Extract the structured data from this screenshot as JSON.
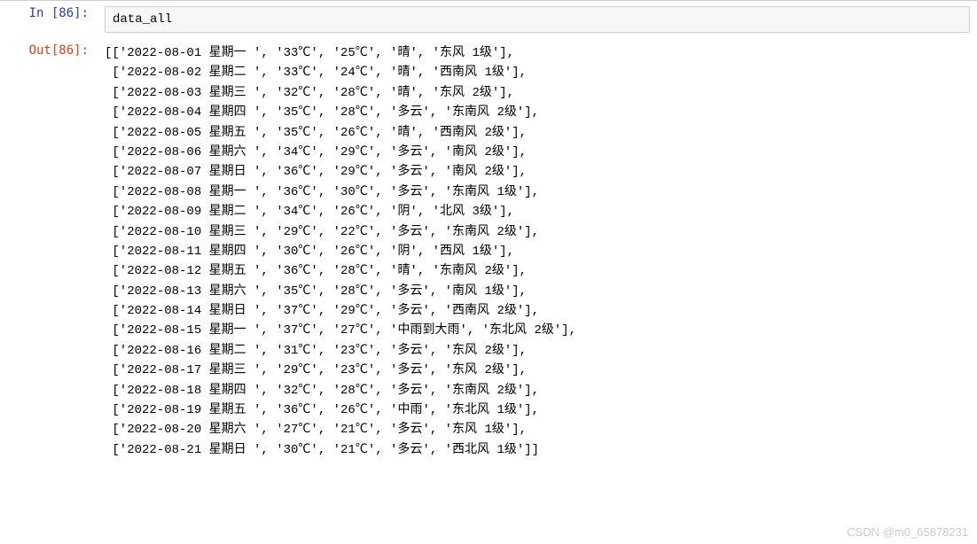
{
  "input": {
    "prompt": "In  [86]:",
    "code": "data_all"
  },
  "output": {
    "prompt": "Out[86]:",
    "rows": [
      [
        "2022-08-01 星期一 ",
        "33℃",
        "25℃",
        "晴",
        "东风 1级"
      ],
      [
        "2022-08-02 星期二 ",
        "33℃",
        "24℃",
        "晴",
        "西南风 1级"
      ],
      [
        "2022-08-03 星期三 ",
        "32℃",
        "28℃",
        "晴",
        "东风 2级"
      ],
      [
        "2022-08-04 星期四 ",
        "35℃",
        "28℃",
        "多云",
        "东南风 2级"
      ],
      [
        "2022-08-05 星期五 ",
        "35℃",
        "26℃",
        "晴",
        "西南风 2级"
      ],
      [
        "2022-08-06 星期六 ",
        "34℃",
        "29℃",
        "多云",
        "南风 2级"
      ],
      [
        "2022-08-07 星期日 ",
        "36℃",
        "29℃",
        "多云",
        "南风 2级"
      ],
      [
        "2022-08-08 星期一 ",
        "36℃",
        "30℃",
        "多云",
        "东南风 1级"
      ],
      [
        "2022-08-09 星期二 ",
        "34℃",
        "26℃",
        "阴",
        "北风 3级"
      ],
      [
        "2022-08-10 星期三 ",
        "29℃",
        "22℃",
        "多云",
        "东南风 2级"
      ],
      [
        "2022-08-11 星期四 ",
        "30℃",
        "26℃",
        "阴",
        "西风 1级"
      ],
      [
        "2022-08-12 星期五 ",
        "36℃",
        "28℃",
        "晴",
        "东南风 2级"
      ],
      [
        "2022-08-13 星期六 ",
        "35℃",
        "28℃",
        "多云",
        "南风 1级"
      ],
      [
        "2022-08-14 星期日 ",
        "37℃",
        "29℃",
        "多云",
        "西南风 2级"
      ],
      [
        "2022-08-15 星期一 ",
        "37℃",
        "27℃",
        "中雨到大雨",
        "东北风 2级"
      ],
      [
        "2022-08-16 星期二 ",
        "31℃",
        "23℃",
        "多云",
        "东风 2级"
      ],
      [
        "2022-08-17 星期三 ",
        "29℃",
        "23℃",
        "多云",
        "东风 2级"
      ],
      [
        "2022-08-18 星期四 ",
        "32℃",
        "28℃",
        "多云",
        "东南风 2级"
      ],
      [
        "2022-08-19 星期五 ",
        "36℃",
        "26℃",
        "中雨",
        "东北风 1级"
      ],
      [
        "2022-08-20 星期六 ",
        "27℃",
        "21℃",
        "多云",
        "东风 1级"
      ],
      [
        "2022-08-21 星期日 ",
        "30℃",
        "21℃",
        "多云",
        "西北风 1级"
      ]
    ]
  },
  "watermark": "CSDN @m0_65878231"
}
